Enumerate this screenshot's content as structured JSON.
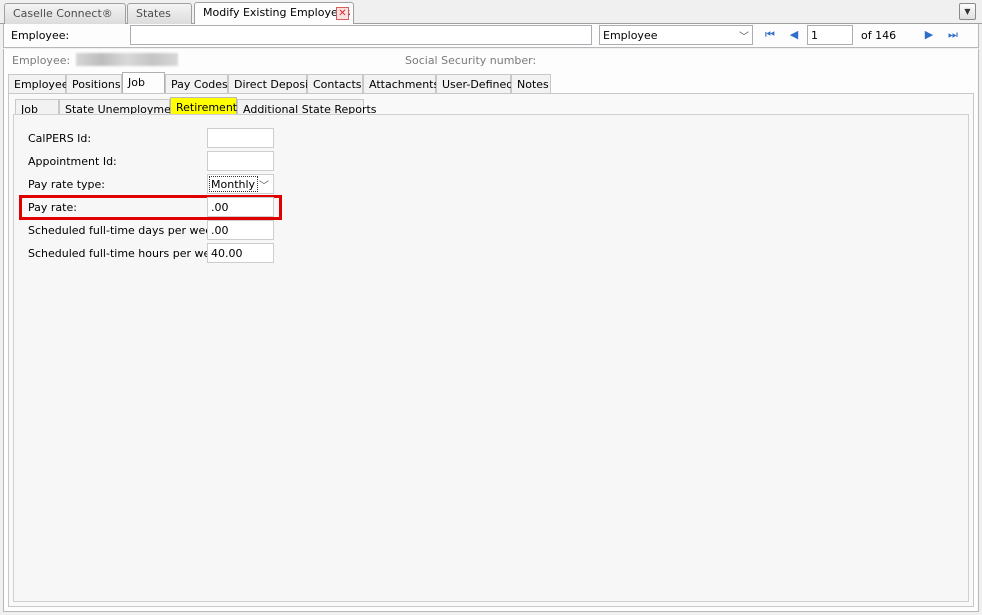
{
  "doc_tabs": [
    {
      "label": "Caselle Connect®"
    },
    {
      "label": "States"
    },
    {
      "label": "Modify Existing Employees"
    }
  ],
  "header": {
    "employee_label": "Employee:",
    "employee_value": "",
    "type_select": "Employee",
    "record_number": "1",
    "record_total": "of 146"
  },
  "info": {
    "employee_label": "Employee:",
    "ssn_label": "Social Security number:"
  },
  "main_tabs": [
    {
      "label": "Employee"
    },
    {
      "label": "Positions"
    },
    {
      "label": "Job"
    },
    {
      "label": "Pay Codes"
    },
    {
      "label": "Direct Deposit"
    },
    {
      "label": "Contacts"
    },
    {
      "label": "Attachments"
    },
    {
      "label": "User-Defined"
    },
    {
      "label": "Notes"
    }
  ],
  "sub_tabs": [
    {
      "label": "Job"
    },
    {
      "label": "State Unemployment"
    },
    {
      "label": "Retirement"
    },
    {
      "label": "Additional State Reports"
    }
  ],
  "form": {
    "calpers_label": "CalPERS Id:",
    "calpers_value": "",
    "appointment_label": "Appointment Id:",
    "appointment_value": "",
    "pay_rate_type_label": "Pay rate type:",
    "pay_rate_type_value": "Monthly",
    "pay_rate_label": "Pay rate:",
    "pay_rate_value": ".00",
    "days_label": "Scheduled full-time days per week:",
    "days_value": ".00",
    "hours_label": "Scheduled full-time hours per week:",
    "hours_value": "40.00"
  },
  "colors": {
    "active_subtab_highlight": "#ffff00",
    "callout_border": "#e00000",
    "nav_icon": "#2f6ec6"
  }
}
